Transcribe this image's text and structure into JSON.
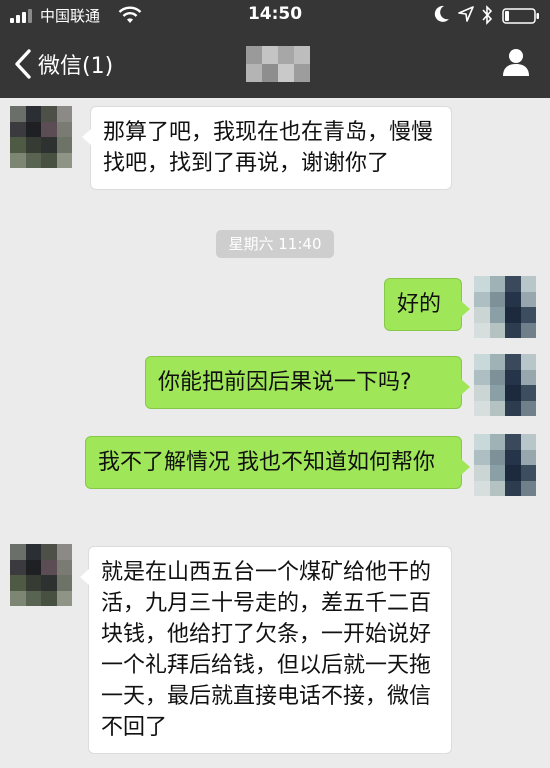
{
  "status_bar": {
    "carrier": "中国联通",
    "time": "14:50",
    "icons": [
      "signal-icon",
      "wifi-icon",
      "moon-icon",
      "location-icon",
      "bluetooth-icon",
      "battery-icon"
    ]
  },
  "nav": {
    "back_label": "微信(1)",
    "title_blurred": true,
    "right_icon": "person-icon"
  },
  "colors": {
    "header_bg": "#363636",
    "chat_bg": "#ebebeb",
    "incoming_bubble": "#ffffff",
    "outgoing_bubble": "#9fe658",
    "timestamp_bg": "#cecece"
  },
  "messages": [
    {
      "direction": "in",
      "text": "那算了吧，我现在也在青岛，慢慢找吧，找到了再说，谢谢你了"
    },
    {
      "type": "timestamp",
      "text": "星期六 11:40"
    },
    {
      "direction": "out",
      "text": "好的"
    },
    {
      "direction": "out",
      "text": "你能把前因后果说一下吗?"
    },
    {
      "direction": "out",
      "text": "我不了解情况 我也不知道如何帮你"
    },
    {
      "direction": "in",
      "text": "就是在山西五台一个煤矿给他干的活，九月三十号走的，差五千二百块钱，他给打了欠条，一开始说好一个礼拜后给钱，但以后就一天拖一天，最后就直接电话不接，微信不回了"
    }
  ]
}
